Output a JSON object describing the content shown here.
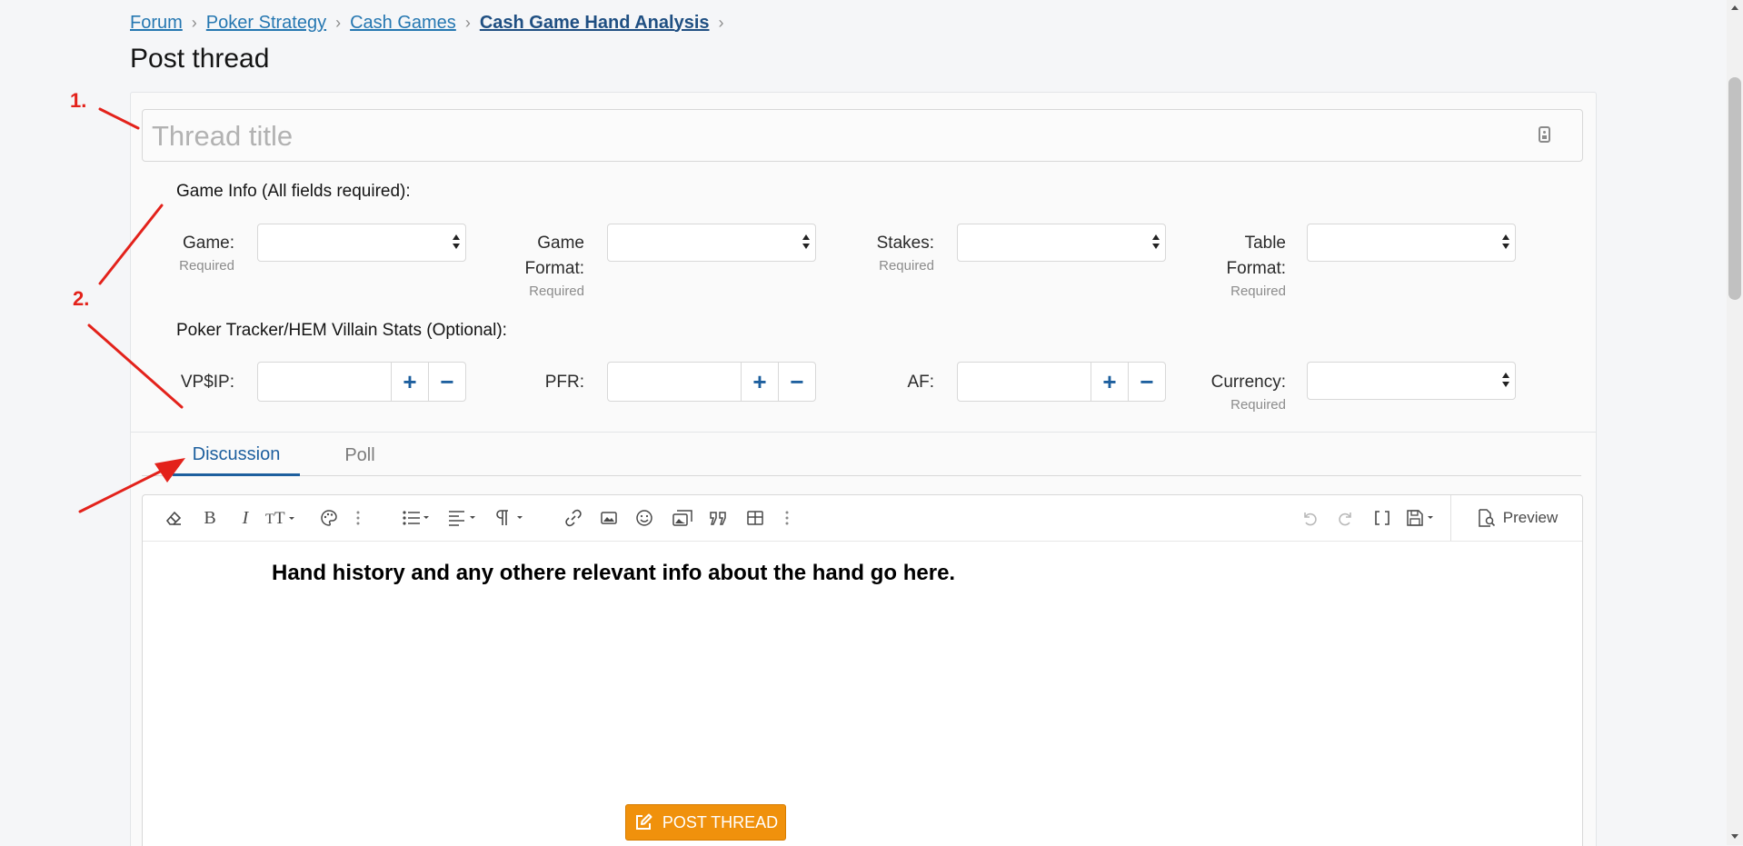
{
  "breadcrumb": {
    "items": [
      "Forum",
      "Poker Strategy",
      "Cash Games",
      "Cash Game Hand Analysis"
    ],
    "separator": "›"
  },
  "page_title": "Post thread",
  "thread_title": {
    "placeholder": "Thread title",
    "value": ""
  },
  "game_info": {
    "heading": "Game Info (All fields required):",
    "fields": [
      {
        "label": "Game:",
        "hint": "Required",
        "value": ""
      },
      {
        "label": "Game Format:",
        "hint": "Required",
        "value": ""
      },
      {
        "label": "Stakes:",
        "hint": "Required",
        "value": ""
      },
      {
        "label": "Table Format:",
        "hint": "Required",
        "value": ""
      }
    ]
  },
  "villain_stats": {
    "heading": "Poker Tracker/HEM Villain Stats (Optional):",
    "fields": [
      {
        "label": "VP$IP:",
        "value": ""
      },
      {
        "label": "PFR:",
        "value": ""
      },
      {
        "label": "AF:",
        "value": ""
      }
    ],
    "currency": {
      "label": "Currency:",
      "hint": "Required",
      "value": ""
    },
    "increment_symbol": "+",
    "decrement_symbol": "−"
  },
  "tabs": [
    {
      "label": "Discussion",
      "active": true
    },
    {
      "label": "Poll",
      "active": false
    }
  ],
  "editor": {
    "toolbar_icons": [
      "eraser-icon",
      "bold-icon",
      "italic-icon",
      "text-size-icon",
      "palette-icon",
      "more-icon",
      "list-icon",
      "align-icon",
      "paragraph-icon",
      "link-icon",
      "image-icon",
      "emoji-icon",
      "media-icon",
      "quote-icon",
      "table-icon",
      "more-icon",
      "undo-icon",
      "redo-icon",
      "bbcode-icon",
      "drafts-icon"
    ],
    "preview_label": "Preview",
    "content": "Hand history and any othere relevant info about the hand go here."
  },
  "submit_label": "POST THREAD",
  "annotations": [
    "1.",
    "2."
  ],
  "colors": {
    "link": "#2577b1",
    "accent": "#1d5f9e",
    "submit": "#f0910c",
    "annotation": "#e3221b"
  }
}
